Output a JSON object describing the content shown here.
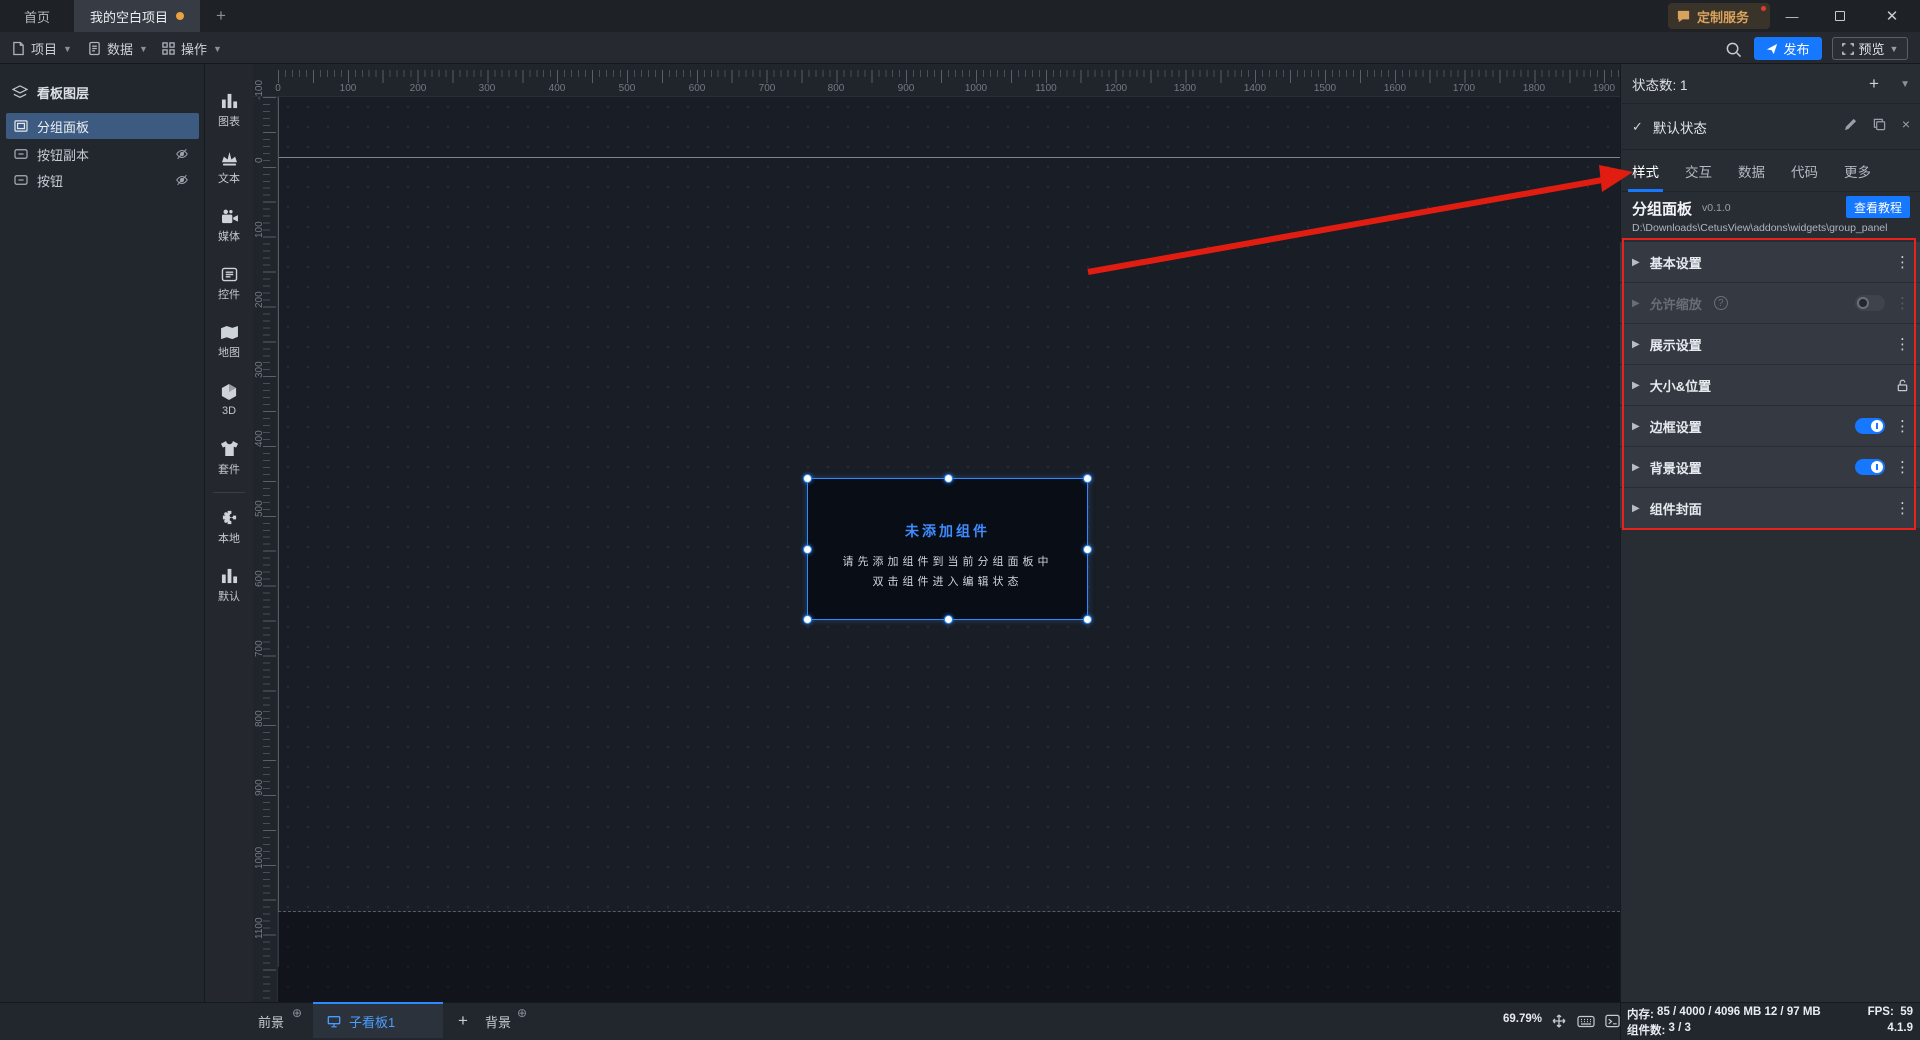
{
  "titlebar": {
    "home_tab": "首页",
    "project_tab": "我的空白项目",
    "service_badge": "定制服务"
  },
  "toolbar": {
    "project": "项目",
    "data": "数据",
    "actions": "操作",
    "publish": "发布",
    "preview": "预览"
  },
  "layers_panel": {
    "title": "看板图层",
    "items": [
      {
        "label": "分组面板",
        "selected": true
      },
      {
        "label": "按钮副本",
        "hidden": true
      },
      {
        "label": "按钮",
        "hidden": true
      }
    ]
  },
  "widget_nav": [
    "图表",
    "文本",
    "媒体",
    "控件",
    "地图",
    "3D",
    "套件",
    "本地",
    "默认"
  ],
  "canvas": {
    "h_ruler": [
      "0",
      "100",
      "200",
      "300",
      "400",
      "500",
      "600",
      "700",
      "800",
      "900",
      "1000",
      "1100",
      "1200",
      "1300",
      "1400",
      "1500",
      "1600",
      "1700",
      "1800",
      "1900"
    ],
    "v_ruler": [
      "-100",
      "0",
      "100",
      "200",
      "300",
      "400",
      "500",
      "600",
      "700",
      "800",
      "900",
      "1000",
      "1100"
    ],
    "selection": {
      "title": "未添加组件",
      "line1": "请先添加组件到当前分组面板中",
      "line2": "双击组件进入编辑状态"
    }
  },
  "state_panel": {
    "count_label": "状态数: 1",
    "state_name": "默认状态",
    "tabs": [
      "样式",
      "交互",
      "数据",
      "代码",
      "更多"
    ],
    "active_tab": "样式",
    "widget_name": "分组面板",
    "widget_version": "v0.1.0",
    "tutorial_button": "查看教程",
    "widget_path": "D:\\Downloads\\CetusView\\addons\\widgets\\group_panel",
    "sections": [
      {
        "title": "基本设置"
      },
      {
        "title": "允许缩放",
        "disabled": true,
        "toggle": "off"
      },
      {
        "title": "展示设置"
      },
      {
        "title": "大小&位置",
        "locked": true
      },
      {
        "title": "边框设置",
        "toggle": "on"
      },
      {
        "title": "背景设置",
        "toggle": "on"
      },
      {
        "title": "组件封面"
      }
    ]
  },
  "bottom_bar": {
    "foreground": "前景",
    "board_tab": "子看板1",
    "background": "背景",
    "zoom": "69.79%",
    "memory_label": "内存:",
    "memory_value": "85 / 4000 / 4096 MB  12 / 97 MB",
    "fps_label": "FPS:",
    "fps_value": "59",
    "widgets_label": "组件数:",
    "widgets_value": "3 / 3",
    "version": "4.1.9"
  }
}
